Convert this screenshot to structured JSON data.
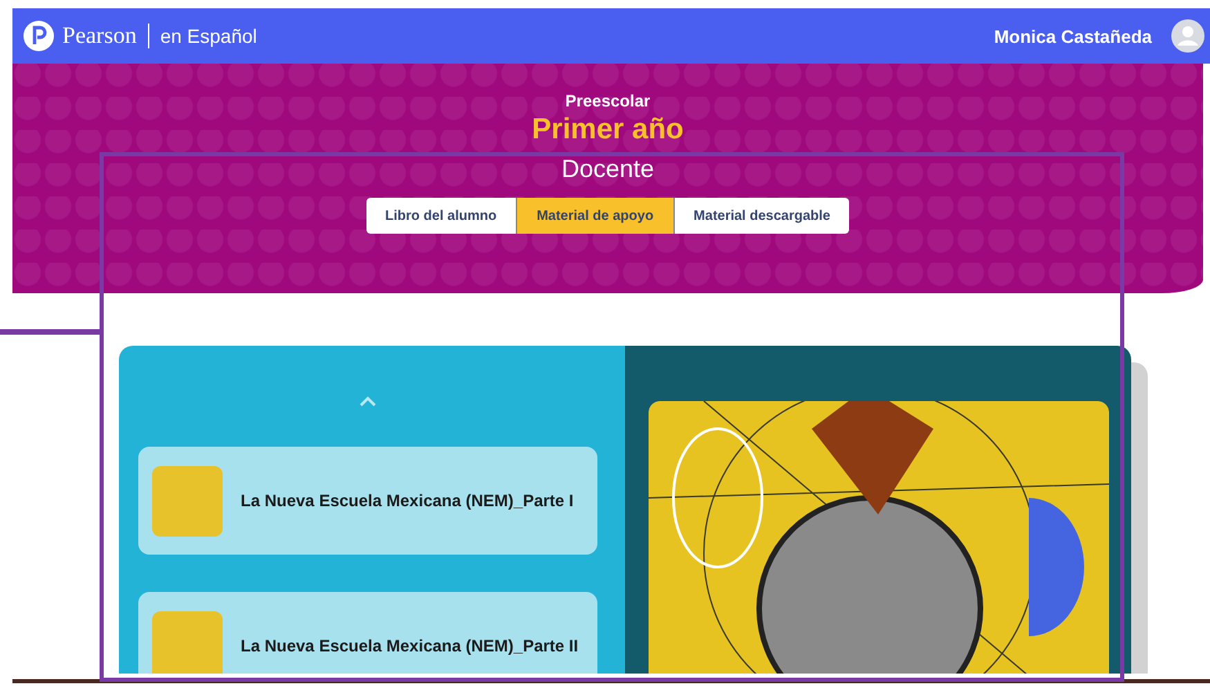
{
  "header": {
    "brand": "Pearson",
    "subtitle": "en Español",
    "user_name": "Monica Castañeda"
  },
  "hero": {
    "level": "Preescolar",
    "title": "Primer año",
    "role": "Docente"
  },
  "tabs": [
    {
      "label": "Libro del alumno",
      "selected": false
    },
    {
      "label": "Material de apoyo",
      "selected": true
    },
    {
      "label": "Material descargable",
      "selected": false
    }
  ],
  "resources": [
    {
      "title": "La Nueva Escuela Mexicana (NEM)_Parte I"
    },
    {
      "title": "La Nueva Escuela Mexicana (NEM)_Parte II"
    }
  ]
}
